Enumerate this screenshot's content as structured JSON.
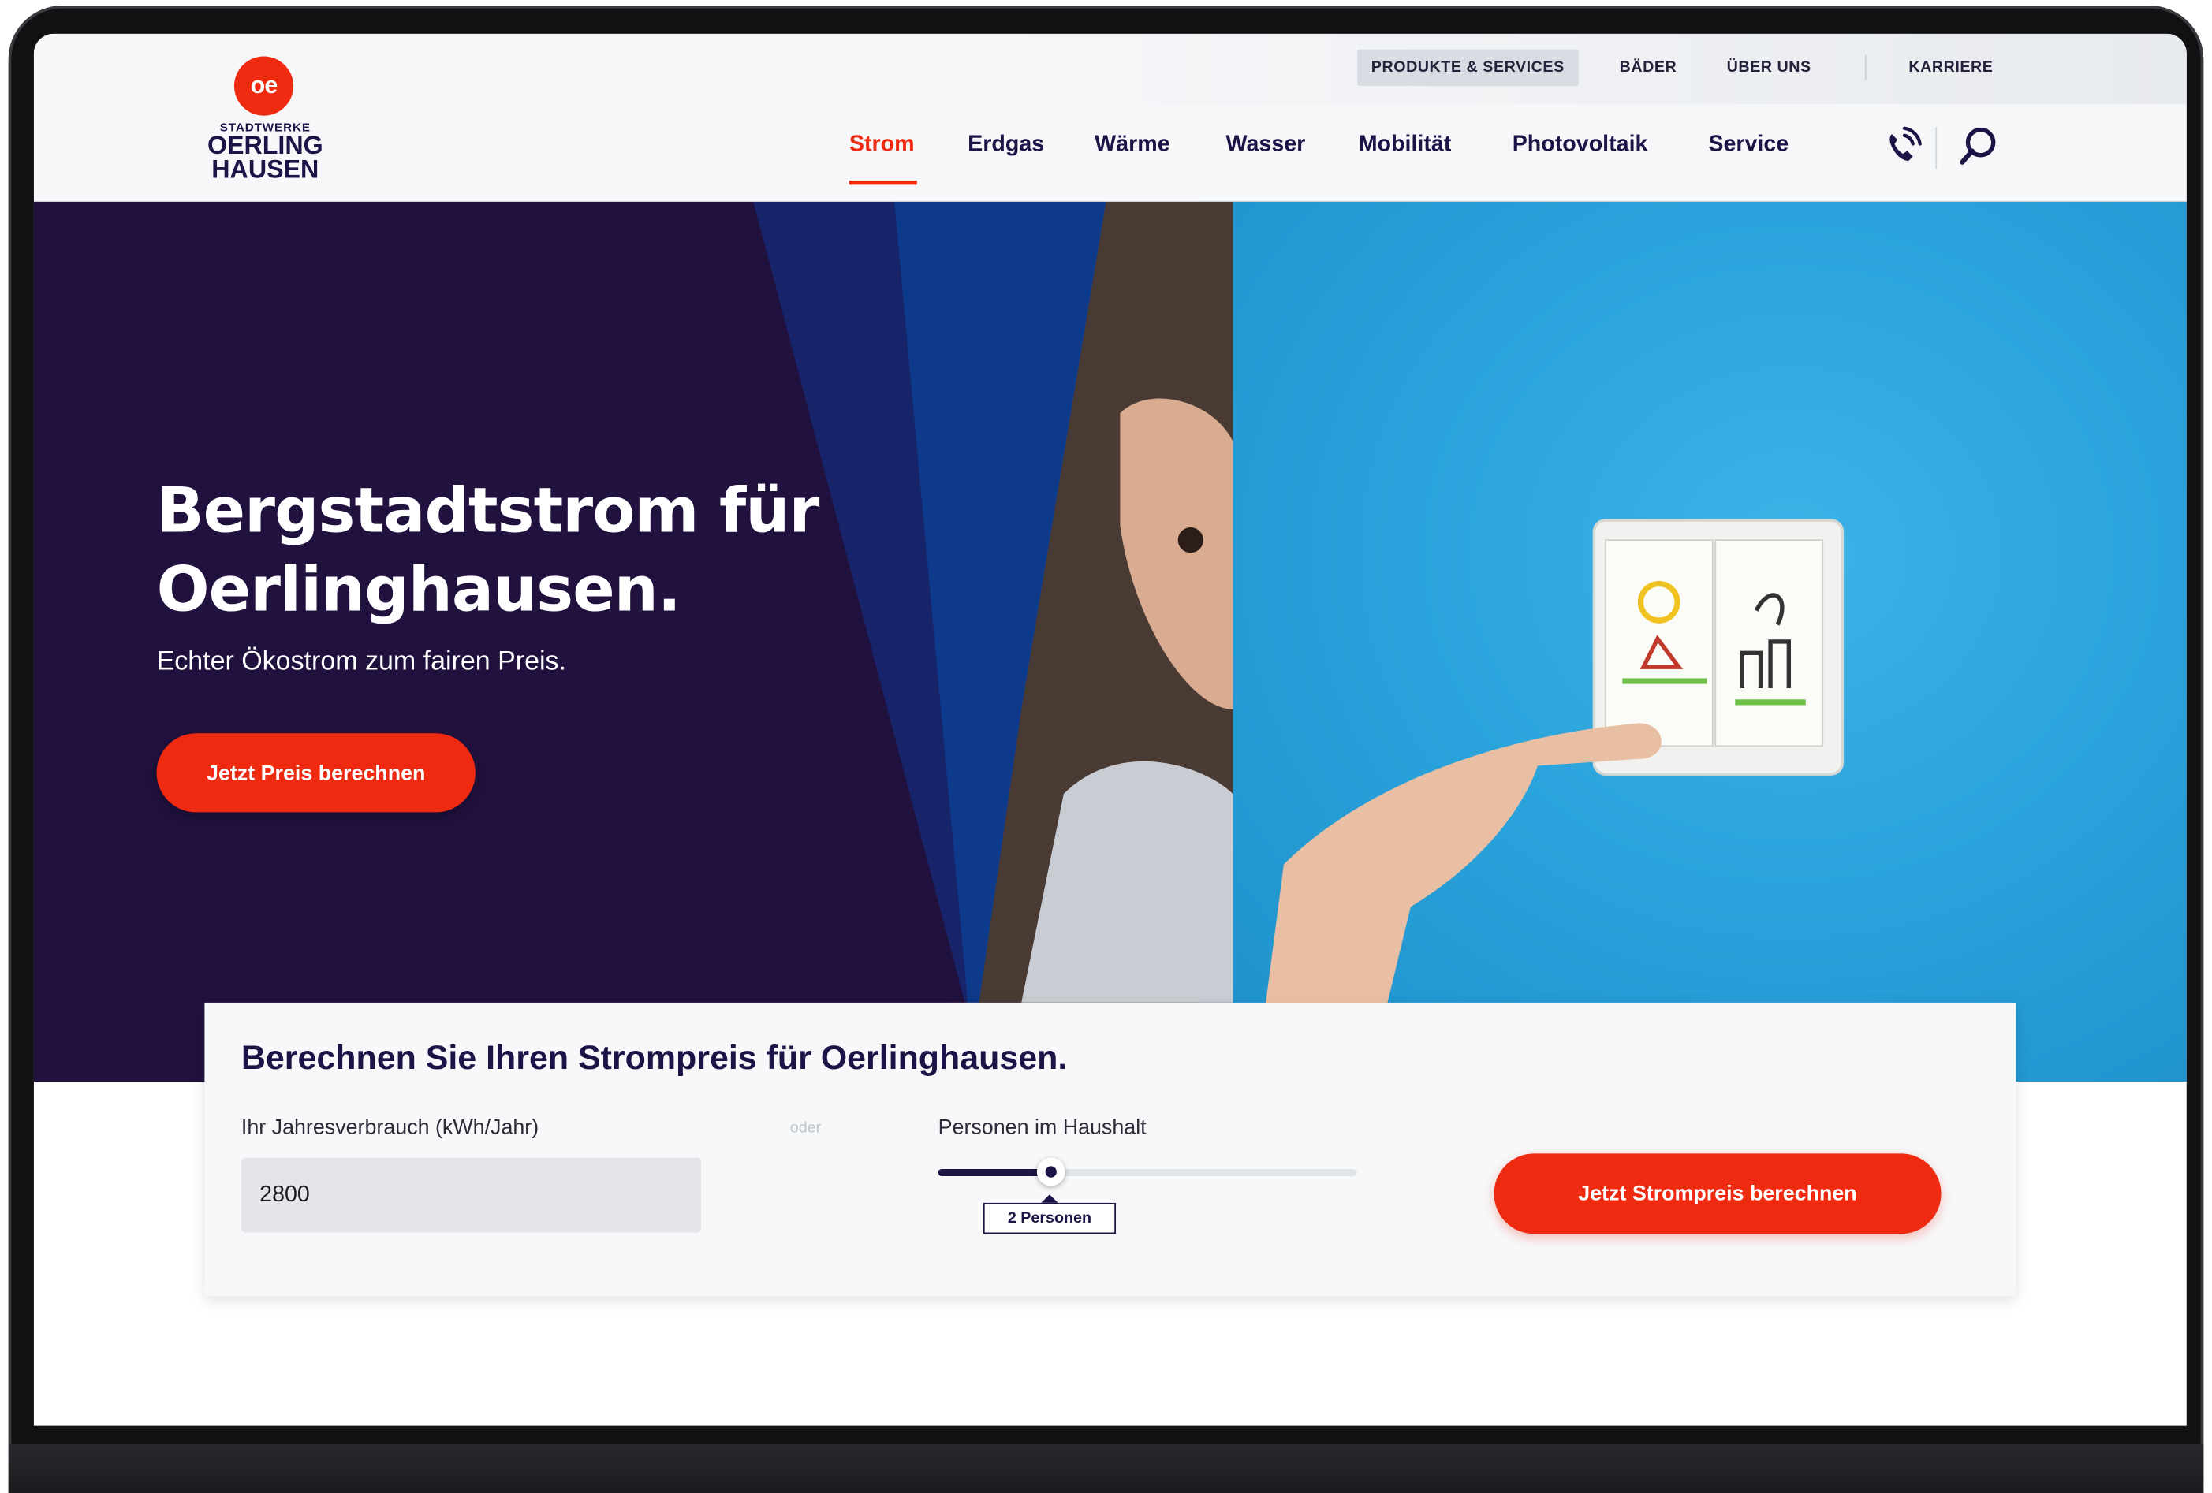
{
  "brand": {
    "logo_mark": "oe",
    "logo_small": "STADTWERKE",
    "logo_line1": "OERLING",
    "logo_line2": "HAUSEN",
    "accent_color": "#ee2a10",
    "navy_color": "#1b1446"
  },
  "meta_nav": {
    "items": [
      {
        "label": "PRODUKTE & SERVICES",
        "active": true
      },
      {
        "label": "BÄDER"
      },
      {
        "label": "ÜBER UNS"
      },
      {
        "label": "KARRIERE"
      }
    ]
  },
  "main_nav": {
    "items": [
      {
        "label": "Strom",
        "active": true
      },
      {
        "label": "Erdgas"
      },
      {
        "label": "Wärme"
      },
      {
        "label": "Wasser"
      },
      {
        "label": "Mobilität"
      },
      {
        "label": "Photovoltaik"
      },
      {
        "label": "Service"
      }
    ],
    "icons": [
      "phone-icon",
      "search-icon"
    ]
  },
  "hero": {
    "title_line1": "Bergstadtstrom für",
    "title_line2": "Oerlinghausen.",
    "subtitle": "Echter Ökostrom zum fairen Preis.",
    "cta_label": "Jetzt Preis berechnen"
  },
  "calculator": {
    "title": "Berechnen Sie Ihren Strompreis für Oerlinghausen.",
    "consumption_label": "Ihr Jahresverbrauch (kWh/Jahr)",
    "consumption_value": "2800",
    "or_label": "oder",
    "persons_label": "Personen im Haushalt",
    "persons_slider_fraction": 0.27,
    "persons_value_label": "2 Personen",
    "cta_label": "Jetzt Strompreis berechnen"
  }
}
